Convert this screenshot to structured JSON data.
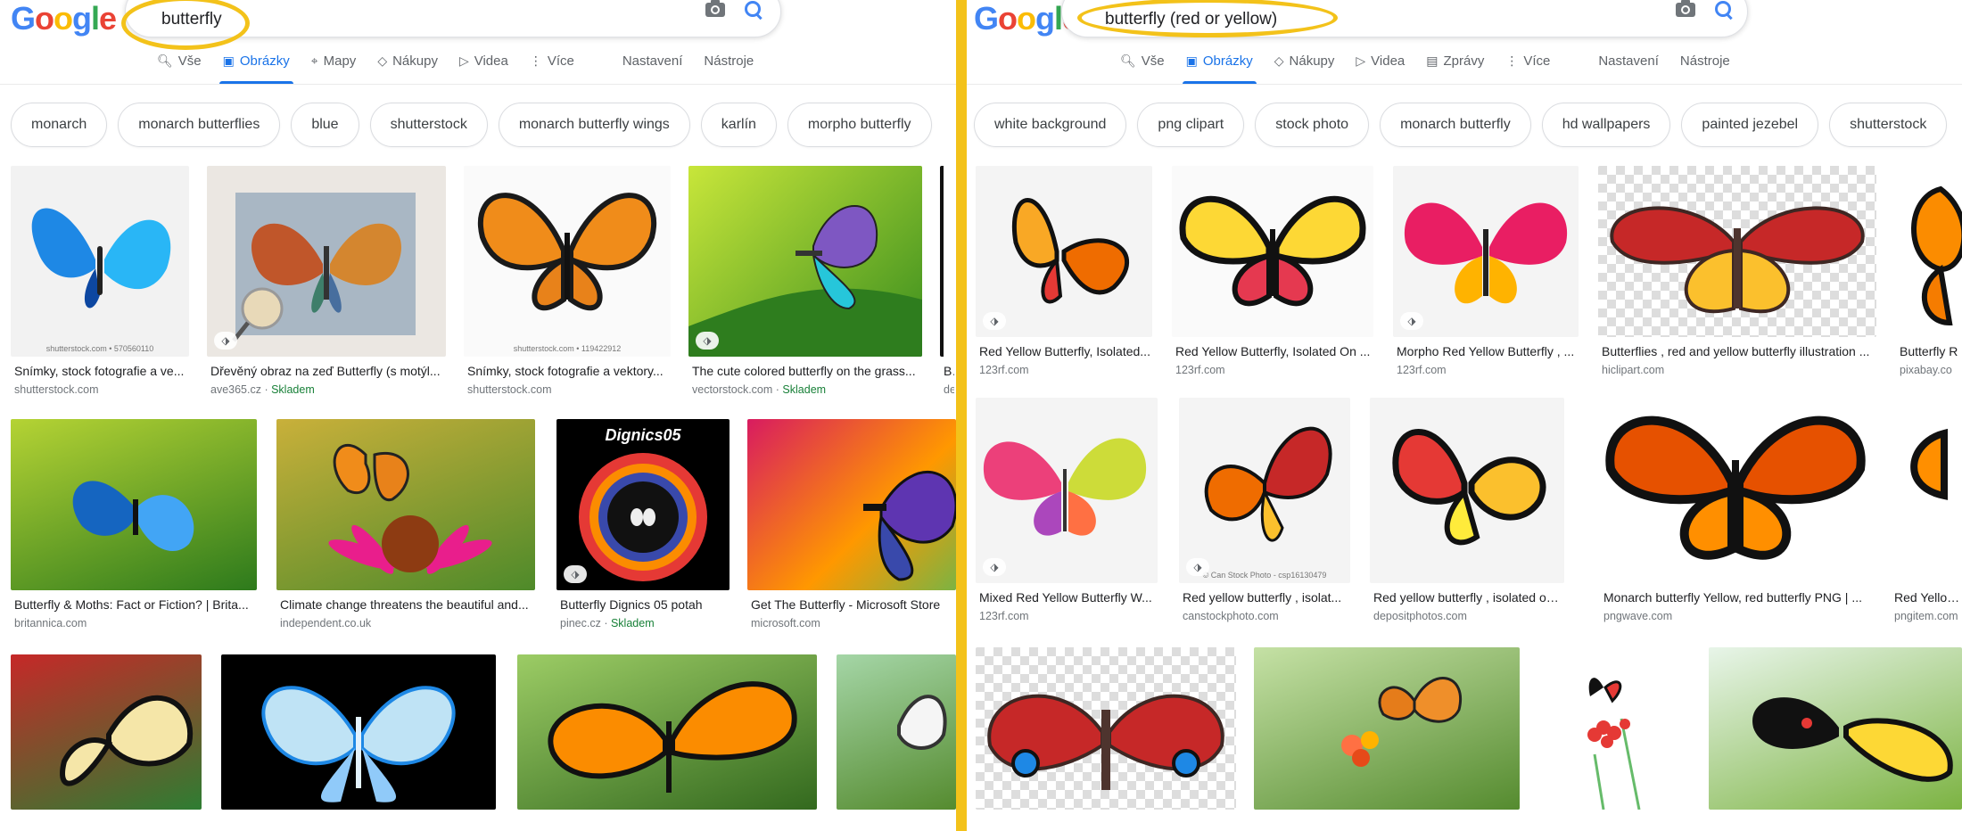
{
  "left": {
    "query": "butterfly",
    "tabs": [
      {
        "label": "Vše",
        "icon": "search-icon",
        "glyph": "🔍︎"
      },
      {
        "label": "Obrázky",
        "icon": "image-icon",
        "glyph": "▣",
        "active": true
      },
      {
        "label": "Mapy",
        "icon": "map-pin-icon",
        "glyph": "⌖"
      },
      {
        "label": "Nákupy",
        "icon": "tag-icon",
        "glyph": "◇"
      },
      {
        "label": "Videa",
        "icon": "play-icon",
        "glyph": "▷"
      },
      {
        "label": "Více",
        "icon": "more-vert-icon",
        "glyph": "⋮"
      }
    ],
    "tools": {
      "settings": "Nastavení",
      "tools": "Nástroje"
    },
    "chips": [
      "monarch",
      "monarch butterflies",
      "blue",
      "shutterstock",
      "monarch butterfly wings",
      "karlín",
      "morpho butterfly"
    ],
    "row1": [
      {
        "title": "Snímky, stock fotografie a ve...",
        "source": "shutterstock.com",
        "stock": "",
        "wm": "shutterstock.com • 570560110"
      },
      {
        "title": "Dřevěný obraz na zeď Butterfly (s motýl...",
        "source": "ave365.cz",
        "stock": "Skladem",
        "wm": ""
      },
      {
        "title": "Snímky, stock fotografie a vektory...",
        "source": "shutterstock.com",
        "stock": "",
        "wm": "shutterstock.com • 119422912"
      },
      {
        "title": "The cute colored butterfly on the grass...",
        "source": "vectorstock.com",
        "stock": "Skladem",
        "wm": ""
      },
      {
        "title": "Bu",
        "source": "de",
        "stock": "",
        "wm": ""
      }
    ],
    "row2": [
      {
        "title": "Butterfly & Moths: Fact or Fiction? | Brita...",
        "source": "britannica.com",
        "stock": ""
      },
      {
        "title": "Climate change threatens the beautiful and...",
        "source": "independent.co.uk",
        "stock": ""
      },
      {
        "title": "Butterfly Dignics 05 potah",
        "source": "pinec.cz",
        "stock": "Skladem",
        "wm": "Dignics05"
      },
      {
        "title": "Get The Butterfly - Microsoft Store",
        "source": "microsoft.com",
        "stock": ""
      }
    ]
  },
  "right": {
    "query": "butterfly (red or yellow)",
    "tabs": [
      {
        "label": "Vše",
        "icon": "search-icon",
        "glyph": "🔍︎"
      },
      {
        "label": "Obrázky",
        "icon": "image-icon",
        "glyph": "▣",
        "active": true
      },
      {
        "label": "Nákupy",
        "icon": "tag-icon",
        "glyph": "◇"
      },
      {
        "label": "Videa",
        "icon": "play-icon",
        "glyph": "▷"
      },
      {
        "label": "Zprávy",
        "icon": "news-icon",
        "glyph": "▤"
      },
      {
        "label": "Více",
        "icon": "more-vert-icon",
        "glyph": "⋮"
      }
    ],
    "tools": {
      "settings": "Nastavení",
      "tools": "Nástroje"
    },
    "chips": [
      "white background",
      "png clipart",
      "stock photo",
      "monarch butterfly",
      "hd wallpapers",
      "painted jezebel",
      "shutterstock"
    ],
    "row1": [
      {
        "title": "Red Yellow Butterfly, Isolated...",
        "source": "123rf.com"
      },
      {
        "title": "Red Yellow Butterfly, Isolated On ...",
        "source": "123rf.com"
      },
      {
        "title": "Morpho Red Yellow Butterfly , ...",
        "source": "123rf.com"
      },
      {
        "title": "Butterflies , red and yellow butterfly illustration ...",
        "source": "hiclipart.com"
      },
      {
        "title": "Butterfly R",
        "source": "pixabay.co"
      }
    ],
    "row2": [
      {
        "title": "Mixed Red Yellow Butterfly W...",
        "source": "123rf.com"
      },
      {
        "title": "Red yellow butterfly , isolat...",
        "source": "canstockphoto.com",
        "wm": "© Can Stock Photo - csp16130479"
      },
      {
        "title": "Red yellow butterfly , isolated on w...",
        "source": "depositphotos.com"
      },
      {
        "title": "Monarch butterfly Yellow, red butterfly PNG | ...",
        "source": "pngwave.com"
      },
      {
        "title": "Red Yellow /",
        "source": "pngitem.com"
      }
    ]
  },
  "colors": {
    "accent": "#1a73e8",
    "highlight": "#f3c21a",
    "stock_green": "#188038"
  }
}
